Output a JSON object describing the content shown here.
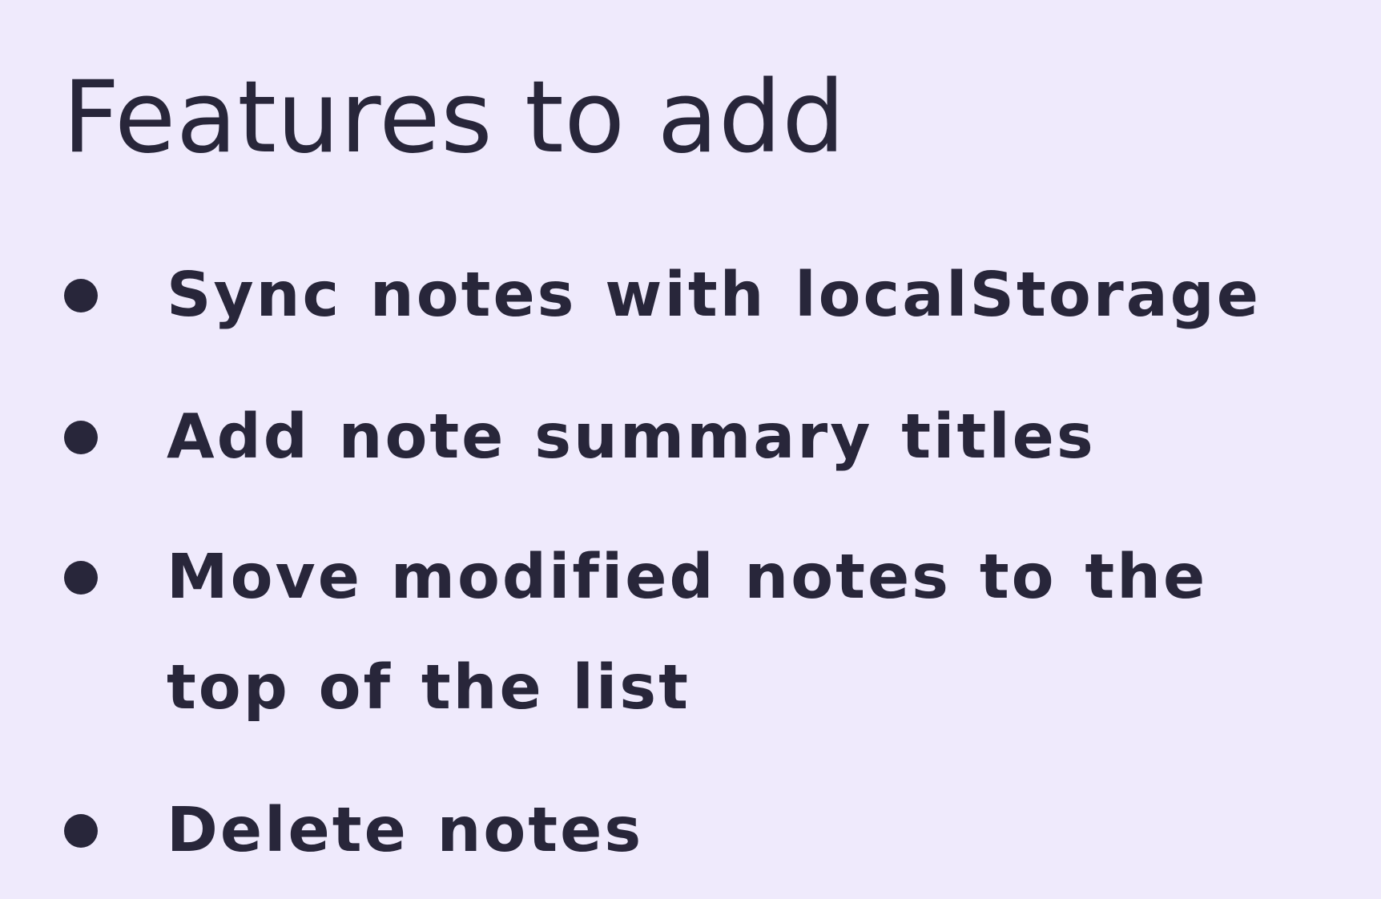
{
  "heading": {
    "title": "Features to add"
  },
  "features": {
    "items": [
      {
        "text": "Sync notes with localStorage"
      },
      {
        "text": "Add note summary titles"
      },
      {
        "text": "Move modified notes to the top of the list"
      },
      {
        "text": "Delete notes"
      }
    ]
  },
  "colors": {
    "background": "#efeafc",
    "text": "#28263a"
  }
}
